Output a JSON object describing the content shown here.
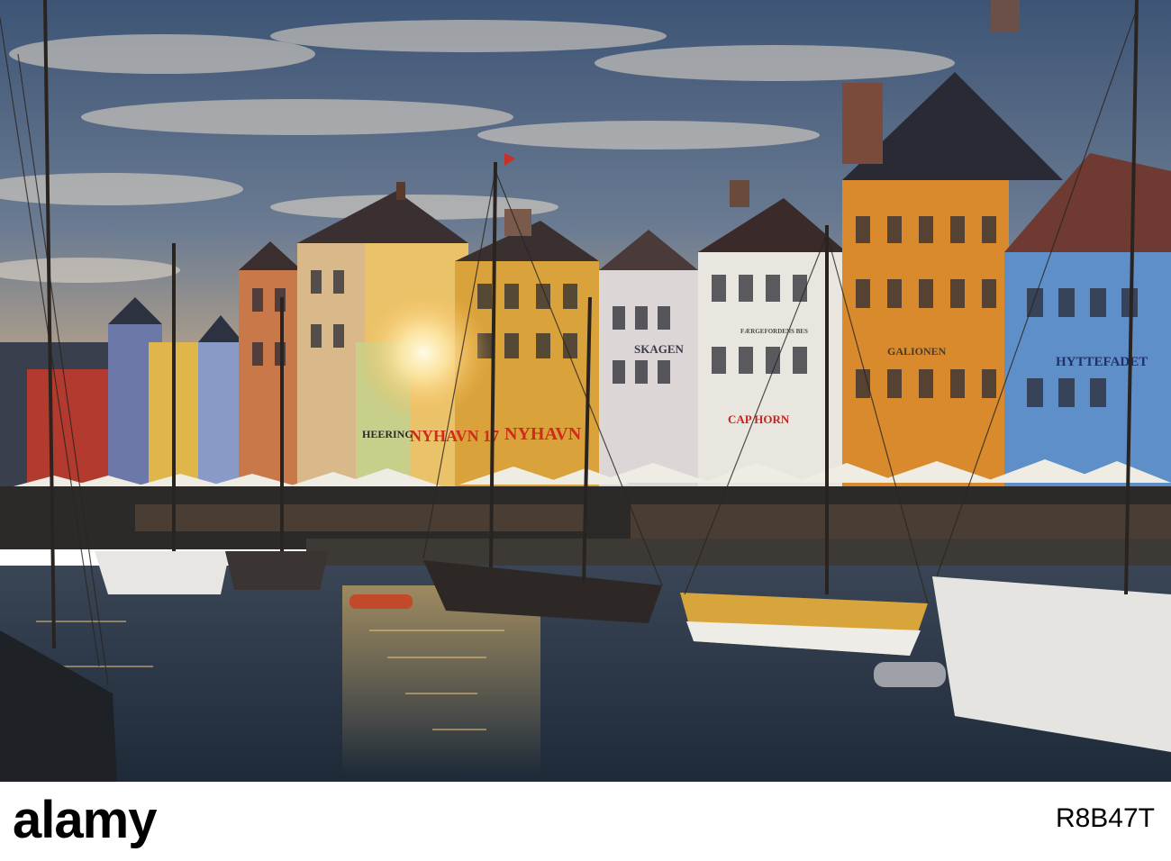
{
  "signs": {
    "heering": "HEERING",
    "nyhavn17": "NYHAVN 17",
    "nyhavn": "NYHAVN",
    "skagen": "SKAGEN",
    "faergekroen": "FÆRGEFORDENS BES",
    "cap_horn": "CAP HORN",
    "galionen": "GALIONEN",
    "hyttefadet": "HYTTEFADET"
  },
  "footer": {
    "brand": "alamy",
    "image_id": "R8B47T"
  },
  "palette": {
    "sky_top": "#3f5778",
    "sky_glow": "#f2c27a",
    "water": "#2a3848",
    "sun": "#fff4c8",
    "house_yellow": "#d8a43a",
    "house_orange": "#d78a2a",
    "house_blue": "#5f8fc8",
    "house_white": "#e8e6df"
  }
}
